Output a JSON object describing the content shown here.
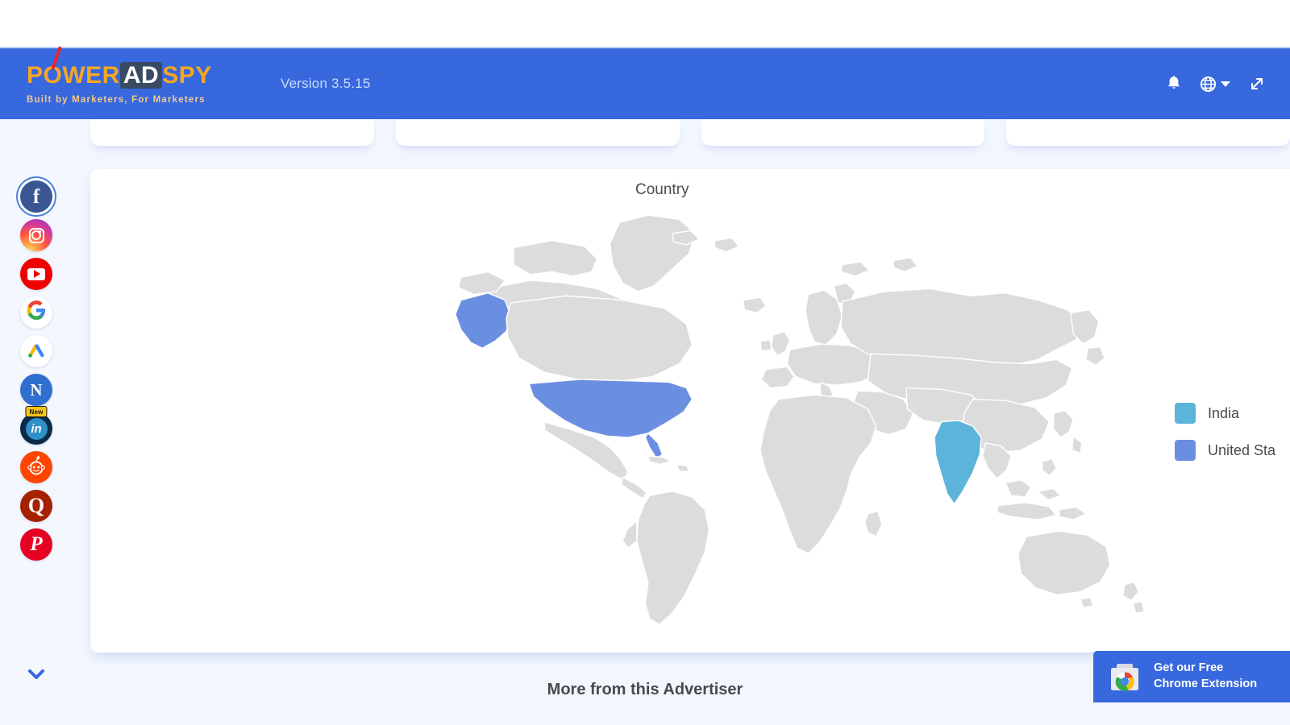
{
  "header": {
    "logo": {
      "part1": "POWER",
      "part2": "AD",
      "part3": "SPY",
      "tagline": "Built by Marketers, For Marketers"
    },
    "version": "Version 3.5.15",
    "icons": {
      "bell": "bell-icon",
      "globe": "globe-icon",
      "expand": "expand-icon"
    },
    "bg_color": "#3868de"
  },
  "sidebar": {
    "items": [
      {
        "name": "facebook",
        "label": "Facebook",
        "selected": true,
        "badge": ""
      },
      {
        "name": "instagram",
        "label": "Instagram",
        "selected": false,
        "badge": ""
      },
      {
        "name": "youtube",
        "label": "YouTube",
        "selected": false,
        "badge": ""
      },
      {
        "name": "google",
        "label": "Google",
        "selected": false,
        "badge": ""
      },
      {
        "name": "google-ads",
        "label": "Google Ads",
        "selected": false,
        "badge": ""
      },
      {
        "name": "native",
        "label": "Native",
        "selected": false,
        "badge": ""
      },
      {
        "name": "linkedin",
        "label": "LinkedIn",
        "selected": false,
        "badge": "New"
      },
      {
        "name": "reddit",
        "label": "Reddit",
        "selected": false,
        "badge": ""
      },
      {
        "name": "quora",
        "label": "Quora",
        "selected": false,
        "badge": ""
      },
      {
        "name": "pinterest",
        "label": "Pinterest",
        "selected": false,
        "badge": ""
      }
    ],
    "expand_icon": "chevron-down-icon"
  },
  "stat_cards": [
    {
      "id": "card-1"
    },
    {
      "id": "card-2"
    },
    {
      "id": "card-3"
    },
    {
      "id": "card-4"
    }
  ],
  "chart_data": {
    "type": "map",
    "title": "Country",
    "legend_position": "right",
    "regions": [
      {
        "name": "India",
        "color": "#5cb4da"
      },
      {
        "name": "United States",
        "color": "#6b8fe0"
      }
    ],
    "base_country_color": "#dcdcdc",
    "border_color": "#ffffff"
  },
  "legend": {
    "items": [
      {
        "label": "India",
        "color": "#5cb4da"
      },
      {
        "label": "United Sta",
        "color": "#6b8fe0"
      }
    ]
  },
  "more_section": {
    "title": "More from this Advertiser"
  },
  "extension_banner": {
    "line1": "Get our Free",
    "line2": "Chrome Extension",
    "icon": "chrome-web-store-icon",
    "bg_color": "#3868de"
  }
}
